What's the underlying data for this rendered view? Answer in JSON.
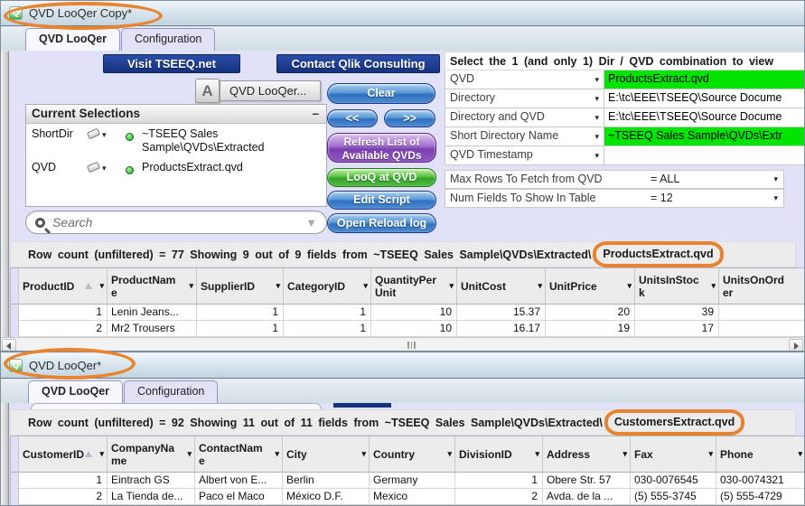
{
  "annotation_color": "#e8842f",
  "top": {
    "title": "QVD LooQer Copy*",
    "tabs": [
      "QVD LooQer",
      "Configuration"
    ],
    "links": {
      "visit": "Visit TSEEQ.net",
      "contact": "Contact Qlik Consulting"
    },
    "text_object": {
      "icon": "A",
      "label": "QVD LooQer..."
    },
    "current_selections": {
      "title": "Current Selections",
      "minimize": "–",
      "rows": [
        {
          "field": "ShortDir",
          "value": "~TSEEQ Sales Sample\\QVDs\\Extracted"
        },
        {
          "field": "QVD",
          "value": "ProductsExtract.qvd"
        }
      ]
    },
    "search_placeholder": "Search",
    "buttons": {
      "clear": "Clear",
      "back": "<<",
      "forward": ">>",
      "refresh": "Refresh List of Available QVDs",
      "looq": "LooQ at QVD",
      "edit_script": "Edit Script",
      "open_log": "Open Reload log"
    },
    "selector": {
      "header": "Select the 1 (and only 1) Dir / QVD combination  to view",
      "rows": [
        {
          "label": "QVD",
          "value": "ProductsExtract.qvd"
        },
        {
          "label": "Directory",
          "value": "E:\\tc\\EEE\\TSEEQ\\Source Docume"
        },
        {
          "label": "Directory and QVD",
          "value": "E:\\tc\\EEE\\TSEEQ\\Source Docume"
        },
        {
          "label": "Short Directory Name",
          "value": "~TSEEQ Sales Sample\\QVDs\\Extr"
        },
        {
          "label": "QVD Timestamp",
          "value": ""
        }
      ]
    },
    "settings": [
      {
        "label": "Max Rows To Fetch from QVD",
        "value": "= ALL"
      },
      {
        "label": "Num Fields To Show In Table",
        "value": "= 12"
      }
    ],
    "status": {
      "prefix": "Row count (unfiltered) = 77   Showing 9 out of 9 fields from ~TSEEQ Sales Sample\\QVDs\\Extracted\\",
      "file": "ProductsExtract.qvd"
    },
    "table": {
      "headers": [
        "ProductID",
        "ProductName",
        "SupplierID",
        "CategoryID",
        "QuantityPerUnit",
        "UnitCost",
        "UnitPrice",
        "UnitsInStock",
        "UnitsOnOrder"
      ],
      "rows": [
        [
          "1",
          "Lenin Jeans...",
          "1",
          "1",
          "10",
          "15.37",
          "20",
          "39",
          ""
        ],
        [
          "2",
          "Mr2 Trousers",
          "1",
          "1",
          "10",
          "16.17",
          "19",
          "17",
          ""
        ]
      ]
    }
  },
  "bottom": {
    "title": "QVD LooQer*",
    "tabs": [
      "QVD LooQer",
      "Configuration"
    ],
    "status": {
      "prefix": "Row count (unfiltered) = 92   Showing 11 out of 11 fields from ~TSEEQ Sales Sample\\QVDs\\Extracted\\",
      "file": "CustomersExtract.qvd"
    },
    "table": {
      "headers": [
        "CustomerID",
        "CompanyName",
        "ContactName",
        "City",
        "Country",
        "DivisionID",
        "Address",
        "Fax",
        "Phone"
      ],
      "rows": [
        [
          "1",
          "Eintrach GS",
          "Albert von E...",
          "Berlin",
          "Germany",
          "1",
          "Obere Str. 57",
          "030-0076545",
          "030-0074321"
        ],
        [
          "2",
          "La Tienda de...",
          "Paco el Maco",
          "México D.F.",
          "Mexico",
          "2",
          "Avda. de la ...",
          "(5) 555-3745",
          "(5) 555-4729"
        ]
      ]
    }
  }
}
